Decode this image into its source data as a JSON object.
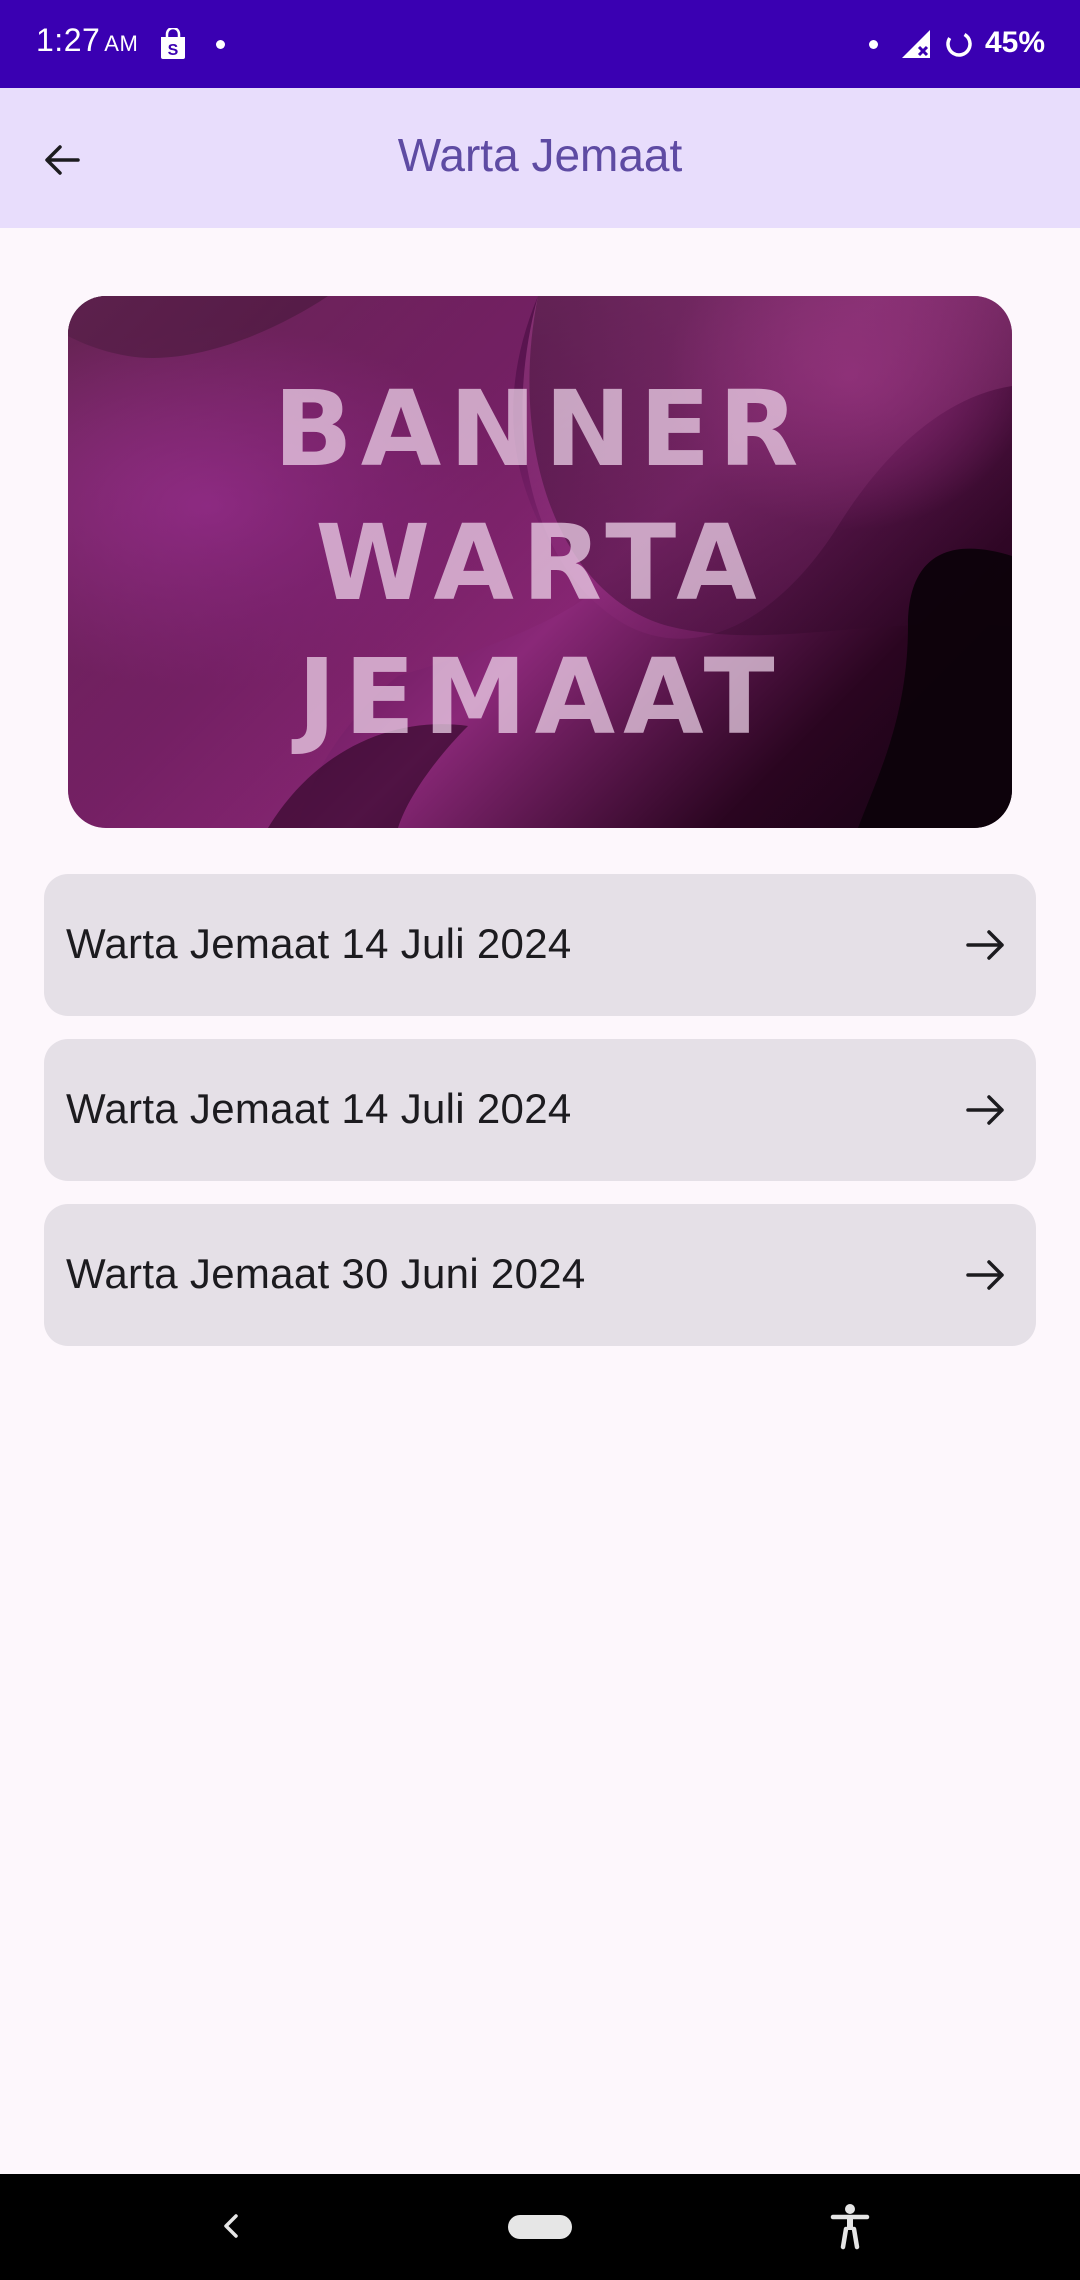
{
  "status_bar": {
    "time": "1:27",
    "ampm": "AM",
    "battery": "45%",
    "icons": [
      "shopping-bag-icon",
      "notification-dot-icon",
      "signal-off-icon",
      "battery-saver-icon"
    ]
  },
  "app_bar": {
    "title": "Warta Jemaat",
    "back_icon": "arrow-back-icon"
  },
  "banner": {
    "lines": [
      "BANNER",
      "WARTA",
      "JEMAAT"
    ]
  },
  "items": [
    {
      "label": "Warta Jemaat 14 Juli 2024",
      "icon": "arrow-forward-icon"
    },
    {
      "label": "Warta Jemaat 14 Juli 2024",
      "icon": "arrow-forward-icon"
    },
    {
      "label": "Warta Jemaat 30 Juni 2024",
      "icon": "arrow-forward-icon"
    }
  ],
  "nav_bar": {
    "icons": [
      "nav-back-icon",
      "home-pill-icon",
      "accessibility-icon"
    ]
  },
  "colors": {
    "status_bar": "#3a00b2",
    "app_bar": "#e8ddfc",
    "title": "#5e4ba3",
    "background": "#fdf7fc",
    "list_item": "#e5e0e7"
  }
}
